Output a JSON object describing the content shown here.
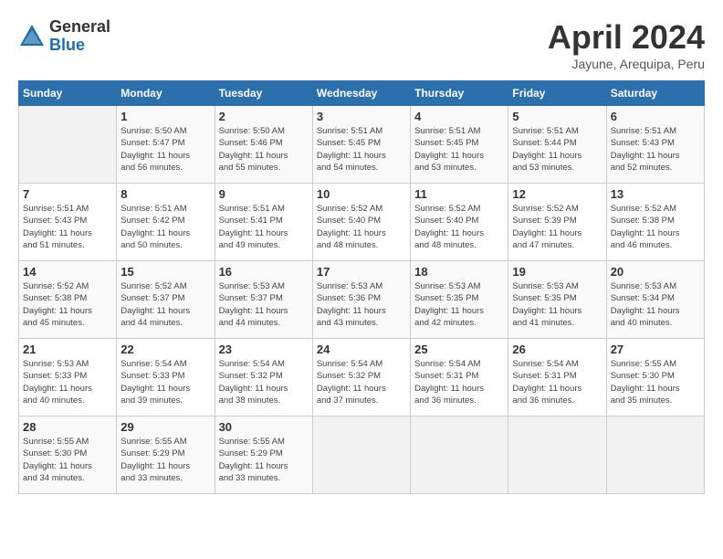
{
  "header": {
    "logo_general": "General",
    "logo_blue": "Blue",
    "month_title": "April 2024",
    "location": "Jayune, Arequipa, Peru"
  },
  "calendar": {
    "days_of_week": [
      "Sunday",
      "Monday",
      "Tuesday",
      "Wednesday",
      "Thursday",
      "Friday",
      "Saturday"
    ],
    "weeks": [
      [
        {
          "day": "",
          "info": ""
        },
        {
          "day": "1",
          "info": "Sunrise: 5:50 AM\nSunset: 5:47 PM\nDaylight: 11 hours\nand 56 minutes."
        },
        {
          "day": "2",
          "info": "Sunrise: 5:50 AM\nSunset: 5:46 PM\nDaylight: 11 hours\nand 55 minutes."
        },
        {
          "day": "3",
          "info": "Sunrise: 5:51 AM\nSunset: 5:45 PM\nDaylight: 11 hours\nand 54 minutes."
        },
        {
          "day": "4",
          "info": "Sunrise: 5:51 AM\nSunset: 5:45 PM\nDaylight: 11 hours\nand 53 minutes."
        },
        {
          "day": "5",
          "info": "Sunrise: 5:51 AM\nSunset: 5:44 PM\nDaylight: 11 hours\nand 53 minutes."
        },
        {
          "day": "6",
          "info": "Sunrise: 5:51 AM\nSunset: 5:43 PM\nDaylight: 11 hours\nand 52 minutes."
        }
      ],
      [
        {
          "day": "7",
          "info": "Sunrise: 5:51 AM\nSunset: 5:43 PM\nDaylight: 11 hours\nand 51 minutes."
        },
        {
          "day": "8",
          "info": "Sunrise: 5:51 AM\nSunset: 5:42 PM\nDaylight: 11 hours\nand 50 minutes."
        },
        {
          "day": "9",
          "info": "Sunrise: 5:51 AM\nSunset: 5:41 PM\nDaylight: 11 hours\nand 49 minutes."
        },
        {
          "day": "10",
          "info": "Sunrise: 5:52 AM\nSunset: 5:40 PM\nDaylight: 11 hours\nand 48 minutes."
        },
        {
          "day": "11",
          "info": "Sunrise: 5:52 AM\nSunset: 5:40 PM\nDaylight: 11 hours\nand 48 minutes."
        },
        {
          "day": "12",
          "info": "Sunrise: 5:52 AM\nSunset: 5:39 PM\nDaylight: 11 hours\nand 47 minutes."
        },
        {
          "day": "13",
          "info": "Sunrise: 5:52 AM\nSunset: 5:38 PM\nDaylight: 11 hours\nand 46 minutes."
        }
      ],
      [
        {
          "day": "14",
          "info": "Sunrise: 5:52 AM\nSunset: 5:38 PM\nDaylight: 11 hours\nand 45 minutes."
        },
        {
          "day": "15",
          "info": "Sunrise: 5:52 AM\nSunset: 5:37 PM\nDaylight: 11 hours\nand 44 minutes."
        },
        {
          "day": "16",
          "info": "Sunrise: 5:53 AM\nSunset: 5:37 PM\nDaylight: 11 hours\nand 44 minutes."
        },
        {
          "day": "17",
          "info": "Sunrise: 5:53 AM\nSunset: 5:36 PM\nDaylight: 11 hours\nand 43 minutes."
        },
        {
          "day": "18",
          "info": "Sunrise: 5:53 AM\nSunset: 5:35 PM\nDaylight: 11 hours\nand 42 minutes."
        },
        {
          "day": "19",
          "info": "Sunrise: 5:53 AM\nSunset: 5:35 PM\nDaylight: 11 hours\nand 41 minutes."
        },
        {
          "day": "20",
          "info": "Sunrise: 5:53 AM\nSunset: 5:34 PM\nDaylight: 11 hours\nand 40 minutes."
        }
      ],
      [
        {
          "day": "21",
          "info": "Sunrise: 5:53 AM\nSunset: 5:33 PM\nDaylight: 11 hours\nand 40 minutes."
        },
        {
          "day": "22",
          "info": "Sunrise: 5:54 AM\nSunset: 5:33 PM\nDaylight: 11 hours\nand 39 minutes."
        },
        {
          "day": "23",
          "info": "Sunrise: 5:54 AM\nSunset: 5:32 PM\nDaylight: 11 hours\nand 38 minutes."
        },
        {
          "day": "24",
          "info": "Sunrise: 5:54 AM\nSunset: 5:32 PM\nDaylight: 11 hours\nand 37 minutes."
        },
        {
          "day": "25",
          "info": "Sunrise: 5:54 AM\nSunset: 5:31 PM\nDaylight: 11 hours\nand 36 minutes."
        },
        {
          "day": "26",
          "info": "Sunrise: 5:54 AM\nSunset: 5:31 PM\nDaylight: 11 hours\nand 36 minutes."
        },
        {
          "day": "27",
          "info": "Sunrise: 5:55 AM\nSunset: 5:30 PM\nDaylight: 11 hours\nand 35 minutes."
        }
      ],
      [
        {
          "day": "28",
          "info": "Sunrise: 5:55 AM\nSunset: 5:30 PM\nDaylight: 11 hours\nand 34 minutes."
        },
        {
          "day": "29",
          "info": "Sunrise: 5:55 AM\nSunset: 5:29 PM\nDaylight: 11 hours\nand 33 minutes."
        },
        {
          "day": "30",
          "info": "Sunrise: 5:55 AM\nSunset: 5:29 PM\nDaylight: 11 hours\nand 33 minutes."
        },
        {
          "day": "",
          "info": ""
        },
        {
          "day": "",
          "info": ""
        },
        {
          "day": "",
          "info": ""
        },
        {
          "day": "",
          "info": ""
        }
      ]
    ]
  }
}
